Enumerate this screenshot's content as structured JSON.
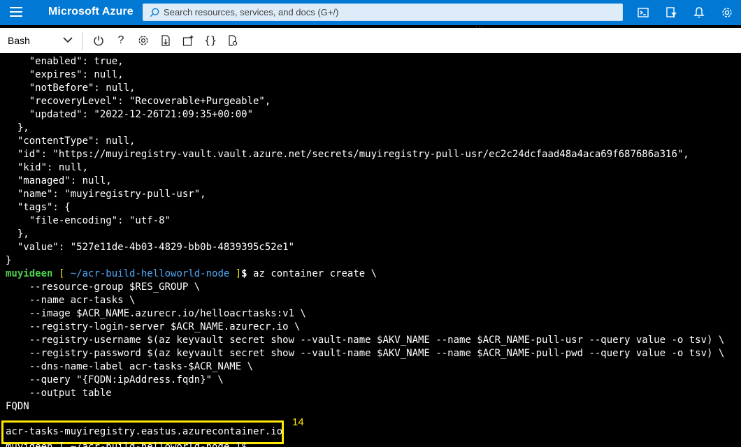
{
  "topbar": {
    "brand": "Microsoft Azure",
    "search_placeholder": "Search resources, services, and docs (G+/)",
    "icons": [
      "cloud-shell-icon",
      "directory-filter-icon",
      "notifications-icon",
      "settings-icon"
    ],
    "accent_color": "#0078d4"
  },
  "shellbar": {
    "shell_type": "Bash",
    "tools": [
      "power-icon",
      "help-icon",
      "settings-icon",
      "upload-download-icon",
      "new-session-icon",
      "editor-icon",
      "web-preview-icon"
    ],
    "help_glyph": "?",
    "editor_glyph": "{}"
  },
  "terminal": {
    "lines": [
      "    \"enabled\": true,",
      "    \"expires\": null,",
      "    \"notBefore\": null,",
      "    \"recoveryLevel\": \"Recoverable+Purgeable\",",
      "    \"updated\": \"2022-12-26T21:09:35+00:00\"",
      "  },",
      "  \"contentType\": null,",
      "  \"id\": \"https://muyiregistry-vault.vault.azure.net/secrets/muyiregistry-pull-usr/ec2c24dcfaad48a4aca69f687686a316\",",
      "  \"kid\": null,",
      "  \"managed\": null,",
      "  \"name\": \"muyiregistry-pull-usr\",",
      "  \"tags\": {",
      "    \"file-encoding\": \"utf-8\"",
      "  },",
      "  \"value\": \"527e11de-4b03-4829-bb0b-4839395c52e1\"",
      "}"
    ],
    "prompt": {
      "user": "muyideen",
      "open_bracket": " [ ",
      "path": "~/acr-build-helloworld-node",
      "close_bracket": " ]",
      "dollar": "$",
      "command": " az container create \\"
    },
    "command_lines": [
      "    --resource-group $RES_GROUP \\",
      "    --name acr-tasks \\",
      "    --image $ACR_NAME.azurecr.io/helloacrtasks:v1 \\",
      "    --registry-login-server $ACR_NAME.azurecr.io \\",
      "    --registry-username $(az keyvault secret show --vault-name $AKV_NAME --name $ACR_NAME-pull-usr --query value -o tsv) \\",
      "    --registry-password $(az keyvault secret show --vault-name $AKV_NAME --name $ACR_NAME-pull-pwd --query value -o tsv) \\",
      "    --dns-name-label acr-tasks-$ACR_NAME \\",
      "    --query \"{FQDN:ipAddress.fqdn}\" \\",
      "    --output table",
      "FQDN"
    ],
    "result": "acr-tasks-muyiregistry.eastus.azurecontainer.io",
    "annotation_number": "14",
    "next_prompt": "muyideen [ ~/acr-build-helloworld-node ]$",
    "highlight_color": "#ffe600"
  }
}
